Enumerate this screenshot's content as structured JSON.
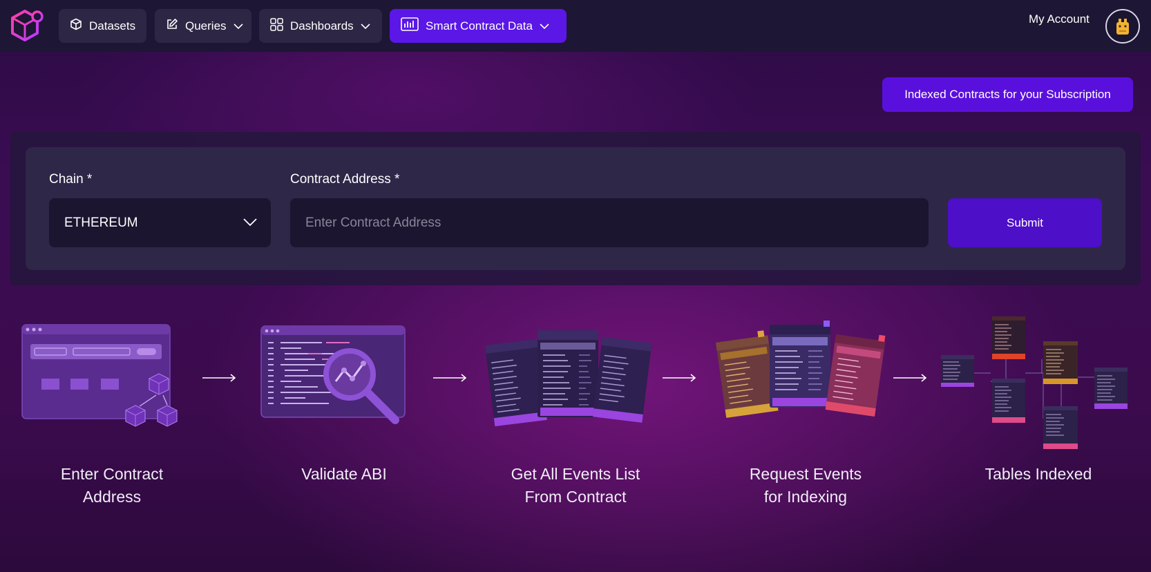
{
  "nav": {
    "items": [
      {
        "label": "Datasets",
        "icon": "cube-icon"
      },
      {
        "label": "Queries",
        "icon": "edit-icon"
      },
      {
        "label": "Dashboards",
        "icon": "grid-icon"
      },
      {
        "label": "Smart Contract Data",
        "icon": "bar-chart-icon"
      }
    ],
    "account_label": "My Account"
  },
  "indexed_button": "Indexed Contracts for your Subscription",
  "form": {
    "chain_label": "Chain *",
    "chain_value": "ETHEREUM",
    "address_label": "Contract Address *",
    "address_placeholder": "Enter Contract Address",
    "address_value": "",
    "submit_label": "Submit"
  },
  "steps": [
    {
      "line1": "Enter Contract",
      "line2": "Address"
    },
    {
      "line1": "Validate ABI",
      "line2": ""
    },
    {
      "line1": "Get All Events List",
      "line2": "From Contract"
    },
    {
      "line1": "Request Events",
      "line2": "for Indexing"
    },
    {
      "line1": "Tables Indexed",
      "line2": ""
    }
  ],
  "colors": {
    "accent": "#5a17e6",
    "submit": "#4d0fc8",
    "panel": "#2f2748"
  }
}
